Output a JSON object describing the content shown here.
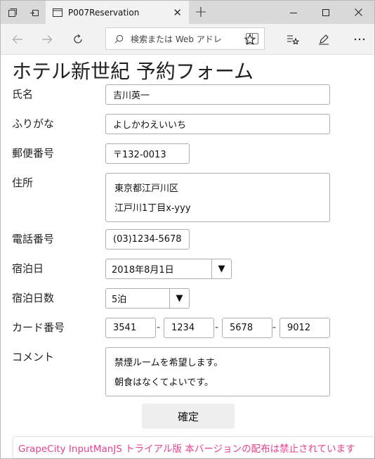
{
  "browser": {
    "tab_title": "P007Reservation",
    "address_placeholder": "検索または Web アドレ"
  },
  "form": {
    "title": "ホテル新世紀 予約フォーム",
    "name": {
      "label": "氏名",
      "value": "吉川英一"
    },
    "furigana": {
      "label": "ふりがな",
      "value": "よしかわえいいち"
    },
    "postal": {
      "label": "郵便番号",
      "value": "〒132-0013"
    },
    "address": {
      "label": "住所",
      "line1": "東京都江戸川区",
      "line2": "江戸川1丁目x-yyy"
    },
    "phone": {
      "label": "電話番号",
      "value": "(03)1234-5678"
    },
    "checkin": {
      "label": "宿泊日",
      "value": "2018年8月1日"
    },
    "nights": {
      "label": "宿泊日数",
      "value": "5泊"
    },
    "card": {
      "label": "カード番号",
      "parts": [
        "3541",
        "1234",
        "5678",
        "9012"
      ]
    },
    "comment": {
      "label": "コメント",
      "line1": "禁煙ルームを希望します。",
      "line2": "朝食はなくてよいです。"
    },
    "confirm_label": "確定"
  },
  "trial_banner": "GrapeCity InputManJS トライアル版 本バージョンの配布は禁止されています",
  "colors": {
    "trial_text": "#e8418e",
    "titlebar": "#d9d9d9",
    "navbar": "#f2f2f2"
  }
}
